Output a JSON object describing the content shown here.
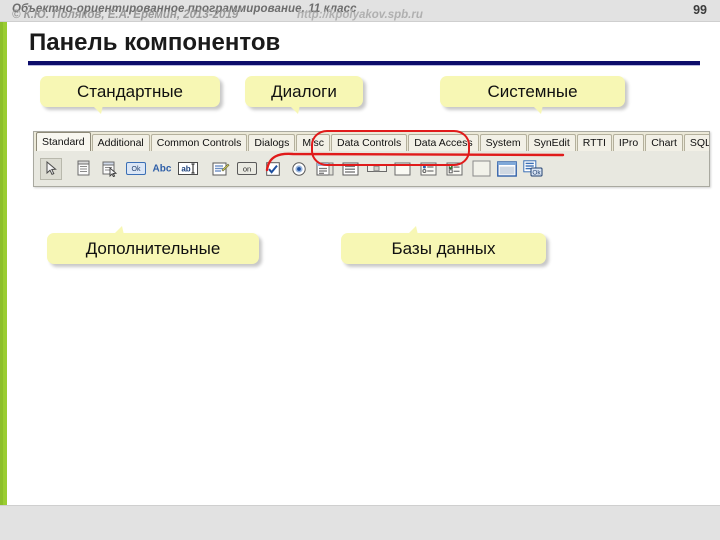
{
  "header": {
    "title": "Объектно-ориентированное программирование, 11 класс",
    "page_number": "99",
    "band_color": "#e2e2e2",
    "text_color": "#6d6d6d"
  },
  "slide": {
    "title": "Панель компонентов",
    "rule_color": "#0d0d6b",
    "spine_color": "#9acd32"
  },
  "callouts": {
    "standard": "Стандартные",
    "dialogs": "Диалоги",
    "system": "Системные",
    "additional": "Дополнительные",
    "database": "Базы данных",
    "fill_color": "#f7f7b4"
  },
  "palette": {
    "tabs": [
      {
        "label": "Standard",
        "active": true
      },
      {
        "label": "Additional",
        "active": false
      },
      {
        "label": "Common Controls",
        "active": false
      },
      {
        "label": "Dialogs",
        "active": false
      },
      {
        "label": "Misc",
        "active": false
      },
      {
        "label": "Data Controls",
        "active": false
      },
      {
        "label": "Data Access",
        "active": false
      },
      {
        "label": "System",
        "active": false
      },
      {
        "label": "SynEdit",
        "active": false
      },
      {
        "label": "RTTI",
        "active": false
      },
      {
        "label": "IPro",
        "active": false
      },
      {
        "label": "Chart",
        "active": false
      },
      {
        "label": "SQLdb",
        "active": false
      }
    ],
    "tools": [
      {
        "name": "pointer-tool",
        "pressed": true
      },
      {
        "name": "tframe-tool",
        "pressed": false
      },
      {
        "name": "tmainmenu-tool",
        "pressed": false
      },
      {
        "name": "tbutton-tool",
        "label": "Ok",
        "pressed": false
      },
      {
        "name": "tlabel-tool",
        "label": "Abc",
        "pressed": false
      },
      {
        "name": "tedit-tool",
        "label": "ab",
        "pressed": false
      },
      {
        "name": "tmemo-tool",
        "pressed": false
      },
      {
        "name": "ttogglebox-tool",
        "label": "on",
        "pressed": false
      },
      {
        "name": "tcheckbox-tool",
        "pressed": false
      },
      {
        "name": "tradiobutton-tool",
        "pressed": false
      },
      {
        "name": "tlistbox-tool",
        "pressed": false
      },
      {
        "name": "tcombobox-tool",
        "pressed": false
      },
      {
        "name": "tscrollbar-tool",
        "pressed": false
      },
      {
        "name": "tgroupbox-tool",
        "pressed": false
      },
      {
        "name": "tradiogroup-tool",
        "pressed": false
      },
      {
        "name": "tcheckgroup-tool",
        "pressed": false
      },
      {
        "name": "tpanel-tool",
        "pressed": false
      },
      {
        "name": "tpaintbox-tool",
        "pressed": false
      },
      {
        "name": "tactionlist-tool",
        "label": "Ok",
        "pressed": false
      }
    ],
    "highlight_color": "#e01b1b"
  },
  "footer": {
    "copyright": "© К.Ю. Поляков, Е.А. Ерёмин, 2013-2019",
    "url": "http://kpolyakov.spb.ru"
  }
}
